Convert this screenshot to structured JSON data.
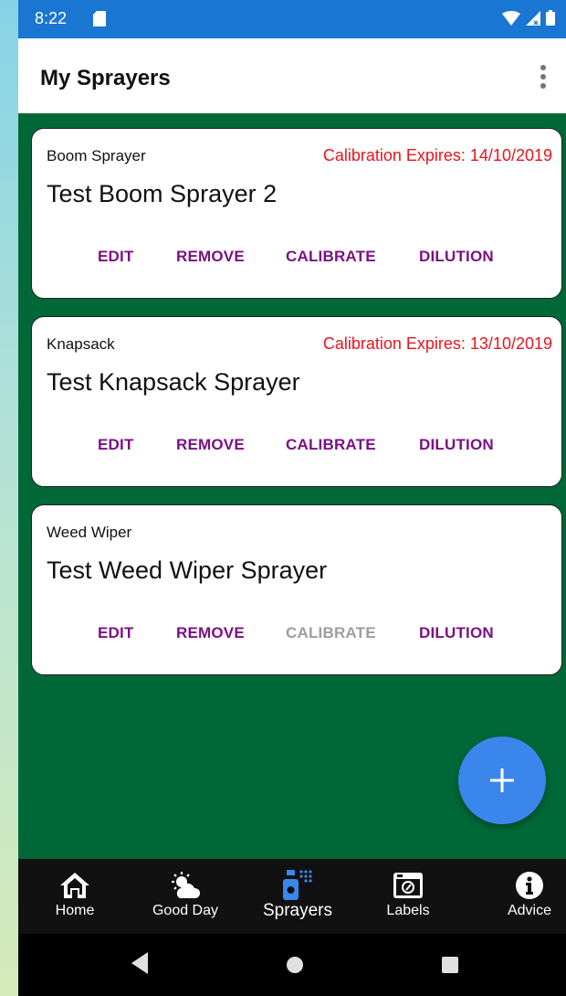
{
  "status_bar": {
    "time": "8:22",
    "icons": [
      "sd-card-icon",
      "wifi-icon",
      "signal-icon",
      "battery-icon"
    ]
  },
  "app_bar": {
    "title": "My Sprayers",
    "menu_icon": "overflow-menu-icon"
  },
  "sprayers": [
    {
      "type": "Boom Sprayer",
      "expiry": "Calibration Expires: 14/10/2019",
      "name": "Test Boom Sprayer 2",
      "calibrate_enabled": true
    },
    {
      "type": "Knapsack",
      "expiry": "Calibration Expires: 13/10/2019",
      "name": "Test Knapsack Sprayer",
      "calibrate_enabled": true
    },
    {
      "type": "Weed Wiper",
      "expiry": "",
      "name": "Test Weed Wiper Sprayer",
      "calibrate_enabled": false
    }
  ],
  "actions": {
    "edit": "EDIT",
    "remove": "REMOVE",
    "calibrate": "CALIBRATE",
    "dilution": "DILUTION"
  },
  "fab": {
    "icon": "add-icon"
  },
  "bottom_nav": {
    "items": [
      {
        "label": "Home",
        "icon": "home-icon"
      },
      {
        "label": "Good Day",
        "icon": "weather-icon"
      },
      {
        "label": "Sprayers",
        "icon": "sprayer-icon"
      },
      {
        "label": "Labels",
        "icon": "label-icon"
      },
      {
        "label": "Advice",
        "icon": "info-icon"
      }
    ],
    "active": "Sprayers"
  },
  "colors": {
    "status_bar": "#1976d2",
    "background": "#006837",
    "action": "#7b1085",
    "action_disabled": "#9e9e9e",
    "expiry": "#e8141c",
    "fab": "#3b86ea",
    "bottom_nav": "#111111"
  }
}
